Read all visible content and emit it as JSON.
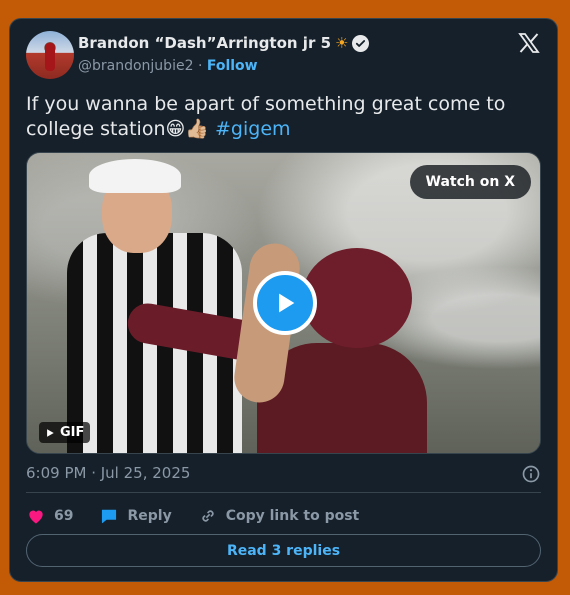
{
  "author": {
    "display_name": "Brandon “Dash”Arrington jr 5",
    "name_emoji": "☀",
    "handle": "@brandonjubie2",
    "separator": "·",
    "follow_label": "Follow",
    "verified": true
  },
  "tweet": {
    "text": "If you wanna be apart of something great come to college station",
    "emojis": "😁👍🏼",
    "hashtag": "#gigem"
  },
  "media": {
    "watch_label": "Watch on X",
    "gif_label": "GIF",
    "play_icon": "play-icon"
  },
  "timestamp": "6:09 PM · Jul 25, 2025",
  "actions": {
    "like_count": "69",
    "reply_label": "Reply",
    "copy_label": "Copy link to post"
  },
  "read_replies_label": "Read 3 replies",
  "colors": {
    "background": "#c25a06",
    "card": "#15202b",
    "accent": "#1d9bf0",
    "link": "#4cb4f7",
    "like": "#f91880"
  }
}
